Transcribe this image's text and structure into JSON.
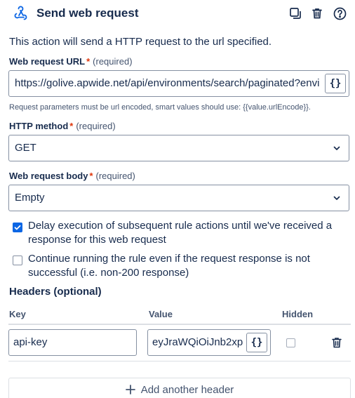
{
  "header": {
    "title": "Send web request",
    "icons": [
      "webhook-icon",
      "duplicate-icon",
      "trash-icon",
      "help-icon"
    ]
  },
  "description": "This action will send a HTTP request to the url specified.",
  "url_field": {
    "label": "Web request URL",
    "required_mark": "*",
    "required_text": "(required)",
    "value": "https://golive.apwide.net/api/environments/search/paginated?envi",
    "smart_button": "{}",
    "hint": "Request parameters must be url encoded, smart values should use: {{value.urlEncode}}."
  },
  "method_field": {
    "label": "HTTP method",
    "required_mark": "*",
    "required_text": "(required)",
    "value": "GET"
  },
  "body_field": {
    "label": "Web request body",
    "required_mark": "*",
    "required_text": "(required)",
    "value": "Empty"
  },
  "options": [
    {
      "checked": true,
      "label": "Delay execution of subsequent rule actions until we've received a response for this web request"
    },
    {
      "checked": false,
      "label": "Continue running the rule even if the request response is not successful (i.e. non-200 response)"
    }
  ],
  "headers": {
    "title": "Headers (optional)",
    "columns": [
      "Key",
      "Value",
      "Hidden"
    ],
    "rows": [
      {
        "key": "api-key",
        "value": "eyJraWQiOiJnb2xp",
        "hidden": false,
        "smart_button": "{}"
      }
    ],
    "add_label": "Add another header"
  },
  "colors": {
    "accent": "#0c66e4",
    "text": "#172b4d",
    "subtle": "#44546f",
    "border": "#8590a2",
    "required": "#de350b"
  }
}
